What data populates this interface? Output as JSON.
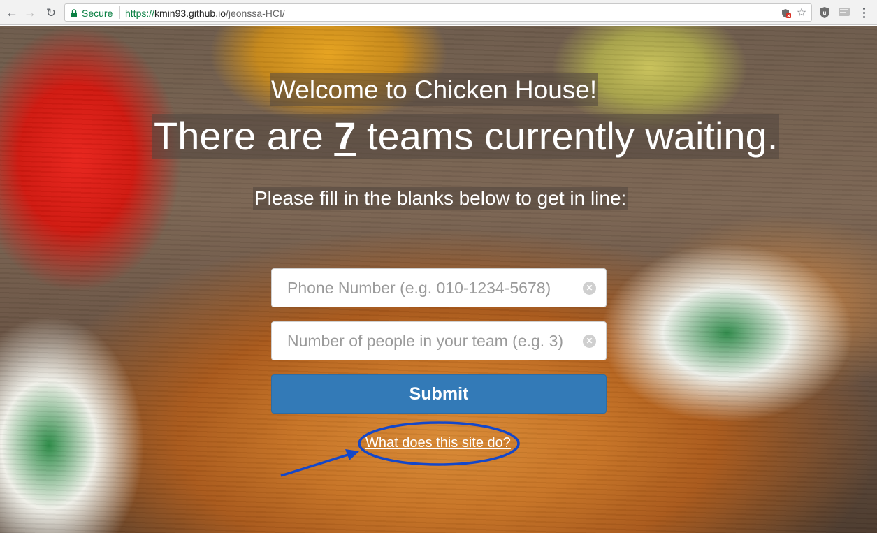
{
  "browser": {
    "secure_label": "Secure",
    "url_scheme": "https://",
    "url_host": "kmin93.github.io",
    "url_path": "/jeonssa-HCI/"
  },
  "page": {
    "title": "Welcome to Chicken House!",
    "waiting_prefix": "There are ",
    "waiting_count": "7",
    "waiting_suffix": " teams currently waiting.",
    "instruction": "Please fill in the blanks below to get in line:",
    "phone_placeholder": "Phone Number (e.g. 010-1234-5678)",
    "people_placeholder": "Number of people in your team (e.g. 3)",
    "submit_label": "Submit",
    "help_link": "What does this site do?"
  },
  "colors": {
    "secure_green": "#0b8043",
    "submit_blue": "#337ab7",
    "annotation_blue": "#1447c9"
  },
  "icons": [
    "back-arrow-icon",
    "forward-arrow-icon",
    "reload-icon",
    "lock-icon",
    "shield-blocked-icon",
    "star-icon",
    "ublock-icon",
    "extension-icon",
    "more-menu-icon",
    "clear-icon"
  ]
}
